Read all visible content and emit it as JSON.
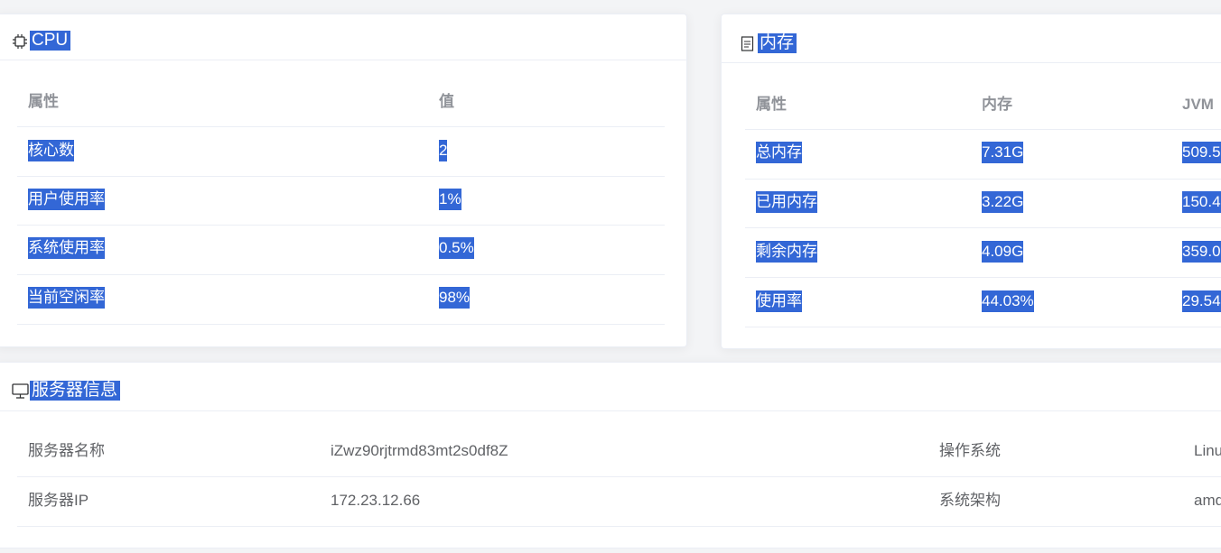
{
  "cpu": {
    "title": "CPU",
    "icon": "cpu-icon",
    "headers": [
      "属性",
      "值"
    ],
    "rows": [
      {
        "name": "核心数",
        "value": "2"
      },
      {
        "name": "用户使用率",
        "value": "1%"
      },
      {
        "name": "系统使用率",
        "value": "0.5%"
      },
      {
        "name": "当前空闲率",
        "value": "98%"
      }
    ]
  },
  "memory": {
    "title": "内存",
    "icon": "document-icon",
    "headers": [
      "属性",
      "内存",
      "JVM"
    ],
    "rows": [
      {
        "name": "总内存",
        "mem": "7.31G",
        "jvm": "509.5"
      },
      {
        "name": "已用内存",
        "mem": "3.22G",
        "jvm": "150.4"
      },
      {
        "name": "剩余内存",
        "mem": "4.09G",
        "jvm": "359.0"
      },
      {
        "name": "使用率",
        "mem": "44.03%",
        "jvm": "29.54"
      }
    ]
  },
  "server": {
    "title": "服务器信息",
    "icon": "monitor-icon",
    "rows": [
      {
        "label1": "服务器名称",
        "value1": "iZwz90rjtrmd83mt2s0df8Z",
        "label2": "操作系统",
        "value2": "Linu"
      },
      {
        "label1": "服务器IP",
        "value1": "172.23.12.66",
        "label2": "系统架构",
        "value2": "amd"
      }
    ]
  },
  "colors": {
    "selection": "#3367d6",
    "header_text": "#909399",
    "body_text": "#606266",
    "border": "#ebeef5"
  }
}
